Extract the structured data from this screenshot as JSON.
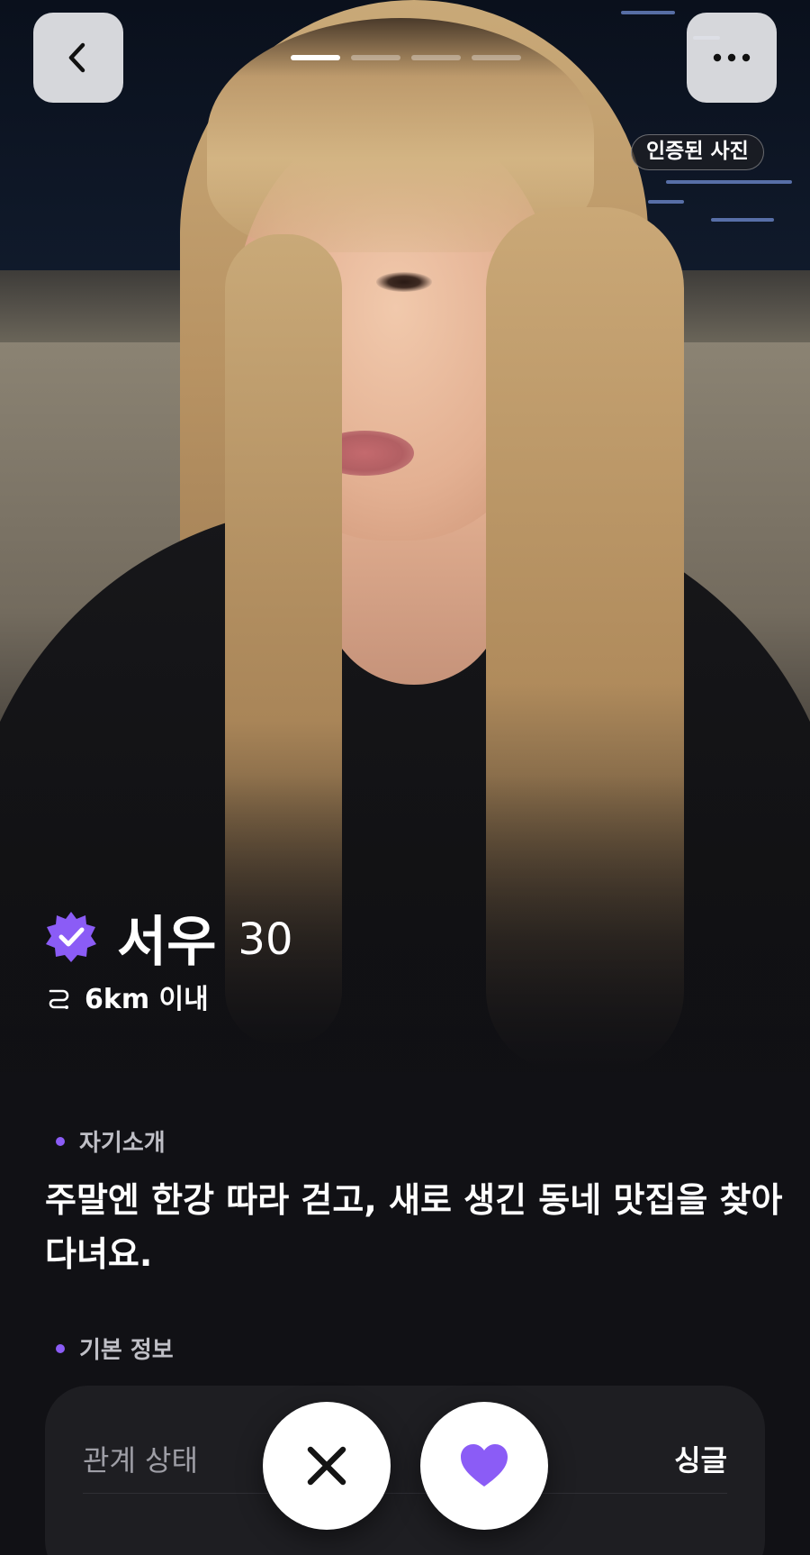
{
  "header": {
    "back_icon": "chevron-left-icon",
    "more_icon": "more-horizontal-icon",
    "photo_count": 4,
    "active_photo_index": 0,
    "verified_photo_label": "인증된 사진"
  },
  "profile": {
    "name": "서우",
    "age": "30",
    "verified_icon": "verified-badge-icon",
    "distance_icon": "route-icon",
    "distance": "6km 이내"
  },
  "sections": {
    "intro": {
      "label": "자기소개",
      "text": "주말엔 한강 따라 걷고, 새로 생긴 동네 맛집을 찾아다녀요."
    },
    "basic_info": {
      "label": "기본 정보",
      "rows": [
        {
          "key": "관계 상태",
          "value": "싱글"
        }
      ]
    }
  },
  "actions": {
    "pass_icon": "close-icon",
    "like_icon": "heart-icon"
  },
  "colors": {
    "accent": "#8b5cf6",
    "background": "#111115",
    "card": "#1e1e22"
  }
}
